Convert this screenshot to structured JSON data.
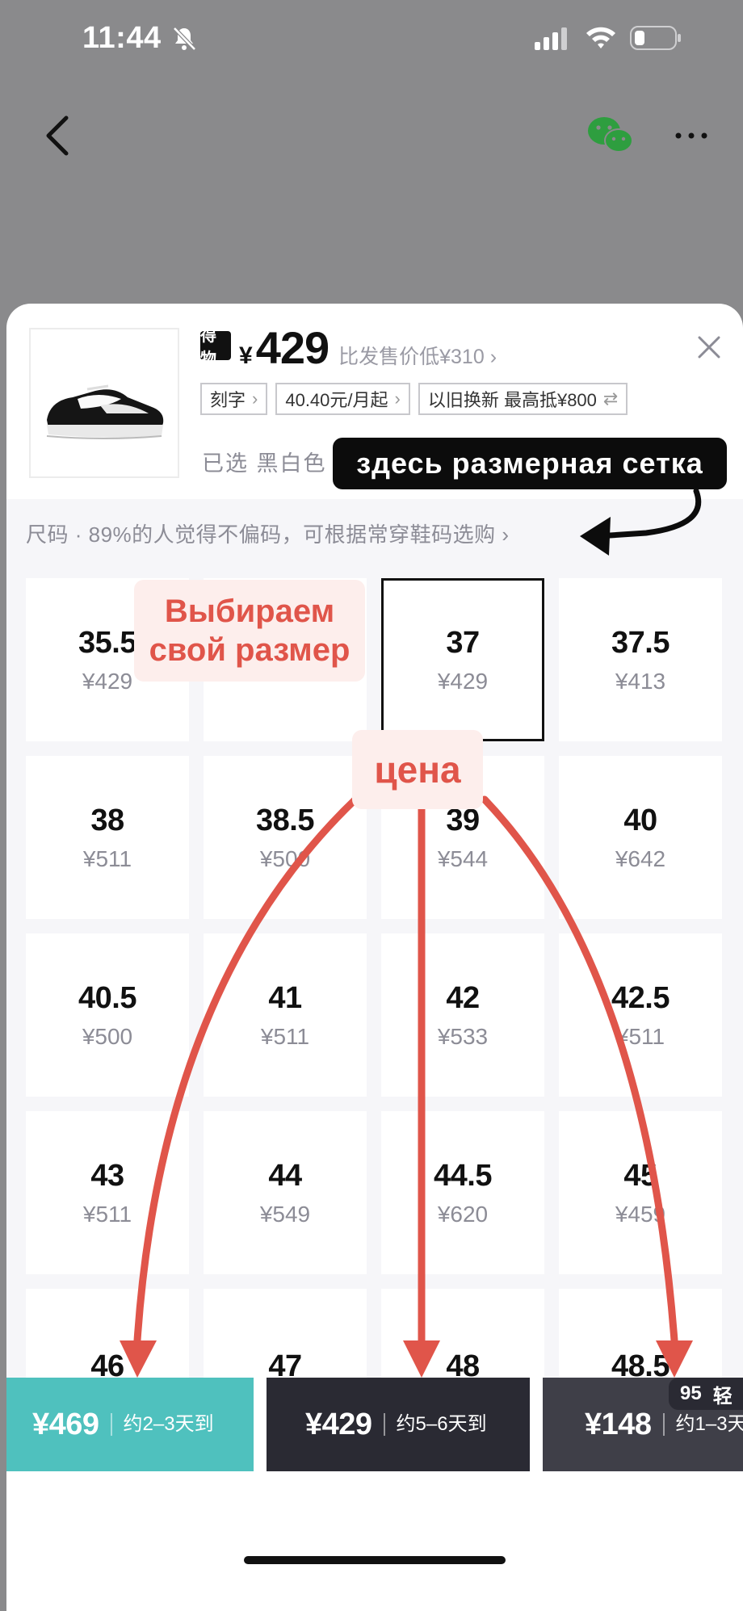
{
  "status_bar": {
    "time": "11:44"
  },
  "product": {
    "brand_logo": "得物",
    "currency": "¥",
    "price": "429",
    "compare_text": "比发售价低¥310",
    "tags": [
      {
        "label": "刻字"
      },
      {
        "label": "40.40元/月起"
      },
      {
        "label": "以旧换新 最高抵¥800",
        "icon": "swap-icon"
      }
    ],
    "selected_text": "已选 黑白色 3"
  },
  "size_hint": "尺码 · 89%的人觉得不偏码，可根据常穿鞋码选购",
  "sizes": [
    {
      "size": "35.5",
      "price": "¥429"
    },
    {
      "size": "",
      "price": ""
    },
    {
      "size": "37",
      "price": "¥429",
      "selected": true
    },
    {
      "size": "37.5",
      "price": "¥413"
    },
    {
      "size": "38",
      "price": "¥511"
    },
    {
      "size": "38.5",
      "price": "¥500"
    },
    {
      "size": "39",
      "price": "¥544"
    },
    {
      "size": "40",
      "price": "¥642"
    },
    {
      "size": "40.5",
      "price": "¥500"
    },
    {
      "size": "41",
      "price": "¥511"
    },
    {
      "size": "42",
      "price": "¥533"
    },
    {
      "size": "42.5",
      "price": "¥511"
    },
    {
      "size": "43",
      "price": "¥511"
    },
    {
      "size": "44",
      "price": "¥549"
    },
    {
      "size": "44.5",
      "price": "¥620"
    },
    {
      "size": "45",
      "price": "¥459"
    },
    {
      "size": "46",
      "price": ""
    },
    {
      "size": "47",
      "price": ""
    },
    {
      "size": "48",
      "price": ""
    },
    {
      "size": "48.5",
      "price": ""
    }
  ],
  "buy_options": [
    {
      "price": "¥469",
      "delivery": "约2–3天到",
      "color": "#4fc1be"
    },
    {
      "price": "¥429",
      "delivery": "约5–6天到",
      "color": "#2a2a33"
    },
    {
      "price": "¥148",
      "delivery": "约1–3天",
      "color": "#3f3f48"
    }
  ],
  "badge": {
    "number": "95",
    "label": "轻"
  },
  "annotations": {
    "size_grid_note": "здесь размерная сетка",
    "choose_size": "Выбираем свой размер",
    "price_note": "цена"
  },
  "colors": {
    "accent_arrow": "#e0554a",
    "teal": "#4fc1be"
  }
}
